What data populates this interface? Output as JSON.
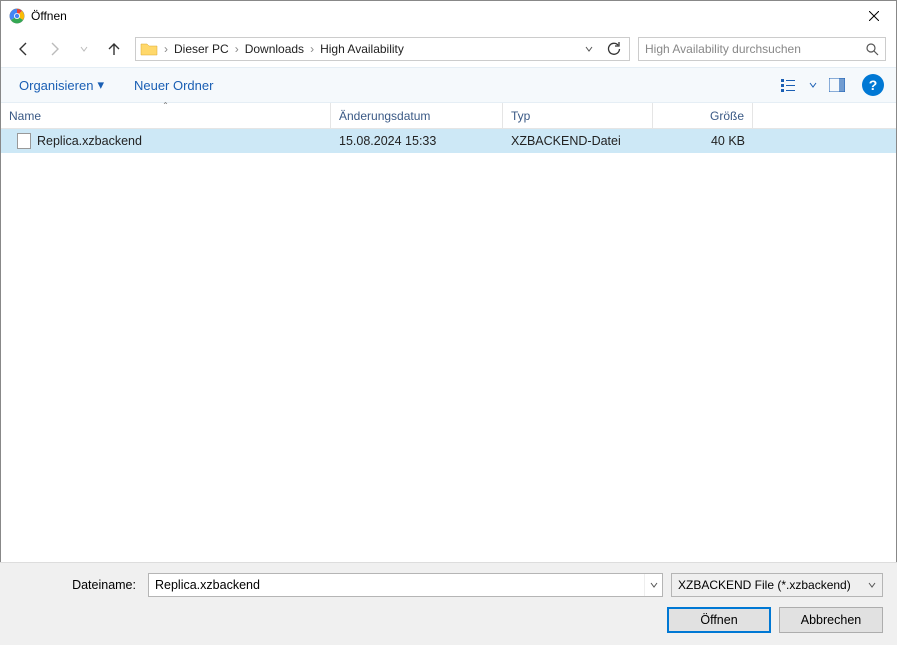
{
  "window": {
    "title": "Öffnen"
  },
  "breadcrumb": {
    "items": [
      "Dieser PC",
      "Downloads",
      "High Availability"
    ]
  },
  "search": {
    "placeholder": "High Availability durchsuchen"
  },
  "toolbar": {
    "organize": "Organisieren",
    "new_folder": "Neuer Ordner"
  },
  "columns": {
    "name": "Name",
    "date": "Änderungsdatum",
    "type": "Typ",
    "size": "Größe"
  },
  "files": [
    {
      "name": "Replica.xzbackend",
      "date": "15.08.2024 15:33",
      "type": "XZBACKEND-Datei",
      "size": "40 KB",
      "selected": true
    }
  ],
  "footer": {
    "filename_label": "Dateiname:",
    "filename_value": "Replica.xzbackend",
    "filter": "XZBACKEND File (*.xzbackend)",
    "open": "Öffnen",
    "cancel": "Abbrechen"
  }
}
